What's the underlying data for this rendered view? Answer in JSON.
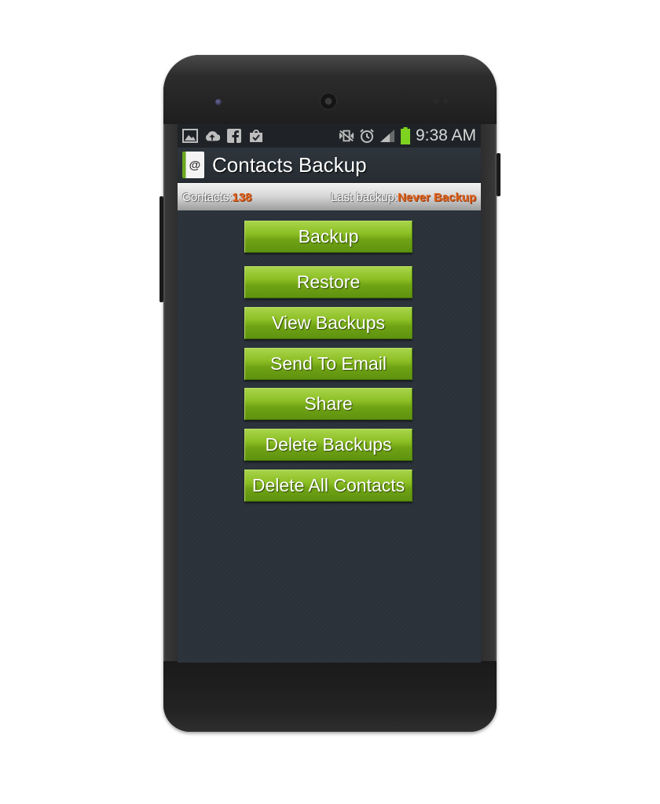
{
  "status_bar": {
    "left_icons": [
      "gallery-icon",
      "cloud-upload-icon",
      "facebook-icon",
      "shopping-bag-icon"
    ],
    "right_icons": [
      "mute-vibrate-icon",
      "alarm-icon",
      "signal-icon",
      "battery-icon"
    ],
    "time": "9:38 AM"
  },
  "app": {
    "title": "Contacts Backup",
    "icon_glyph": "@"
  },
  "info_bar": {
    "contacts_label": "Contacts:",
    "contacts_value": "138",
    "last_backup_label": "Last backup:",
    "last_backup_value": "Never Backup",
    "accent_color": "#e0621f"
  },
  "buttons": [
    {
      "label": "Backup"
    },
    {
      "label": "Restore"
    },
    {
      "label": "View Backups"
    },
    {
      "label": "Send To Email"
    },
    {
      "label": "Share"
    },
    {
      "label": "Delete Backups"
    },
    {
      "label": "Delete All Contacts"
    }
  ],
  "colors": {
    "button_green": "#8cbf24",
    "screen_bg": "#2b323a"
  }
}
